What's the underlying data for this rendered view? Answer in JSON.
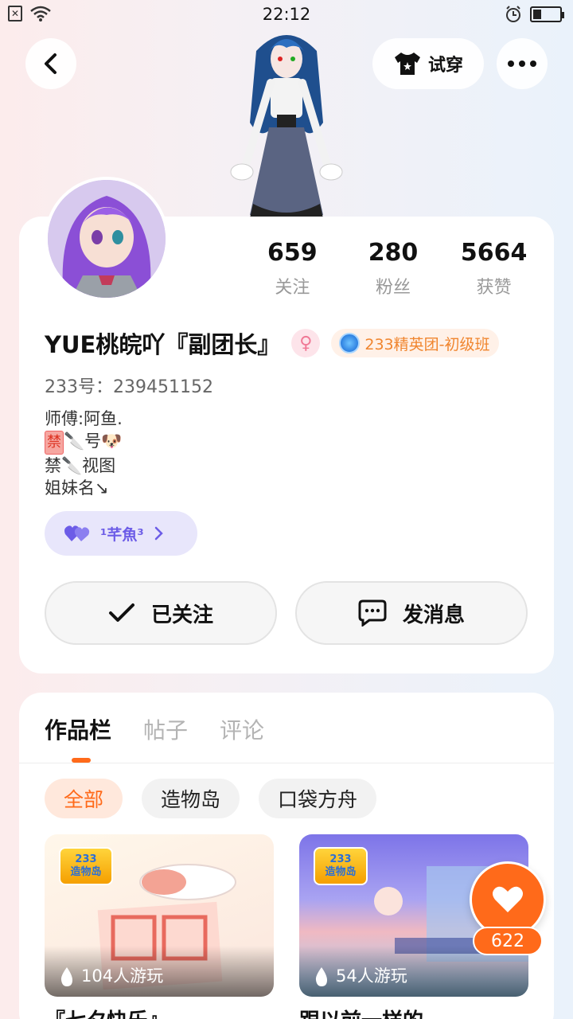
{
  "status_bar": {
    "time": "22:12",
    "battery_level": 0.3
  },
  "header": {
    "tryon_label": "试穿"
  },
  "profile": {
    "stats": [
      {
        "value": "659",
        "label": "关注"
      },
      {
        "value": "280",
        "label": "粉丝"
      },
      {
        "value": "5664",
        "label": "获赞"
      }
    ],
    "name": "YUE桃皖吖『副团长』",
    "group_badge": "233精英团-初级班",
    "uid": "233号：239451152",
    "bio": {
      "line1": "师傅:阿鱼.",
      "line2_prefix": "禁",
      "line2_text": "号",
      "line3": "禁",
      "line3_text": "视图",
      "line4": "姐妹名↘"
    },
    "fan_pill": "¹芊魚³",
    "follow_label": "已关注",
    "message_label": "发消息"
  },
  "works": {
    "tabs": [
      "作品栏",
      "帖子",
      "评论"
    ],
    "filters": [
      "全部",
      "造物岛",
      "口袋方舟"
    ],
    "logo_text_top": "233",
    "logo_text_bottom": "造物岛",
    "games": [
      {
        "plays": "104人游玩",
        "title": "『七夕快乐』"
      },
      {
        "plays": "54人游玩",
        "title": "跟以前一样的"
      }
    ]
  },
  "like_fab": {
    "count": "622"
  },
  "colors": {
    "accent": "#ff6a1a",
    "group_badge_text": "#f0852e",
    "fan_pill": "#6c5ce7"
  }
}
